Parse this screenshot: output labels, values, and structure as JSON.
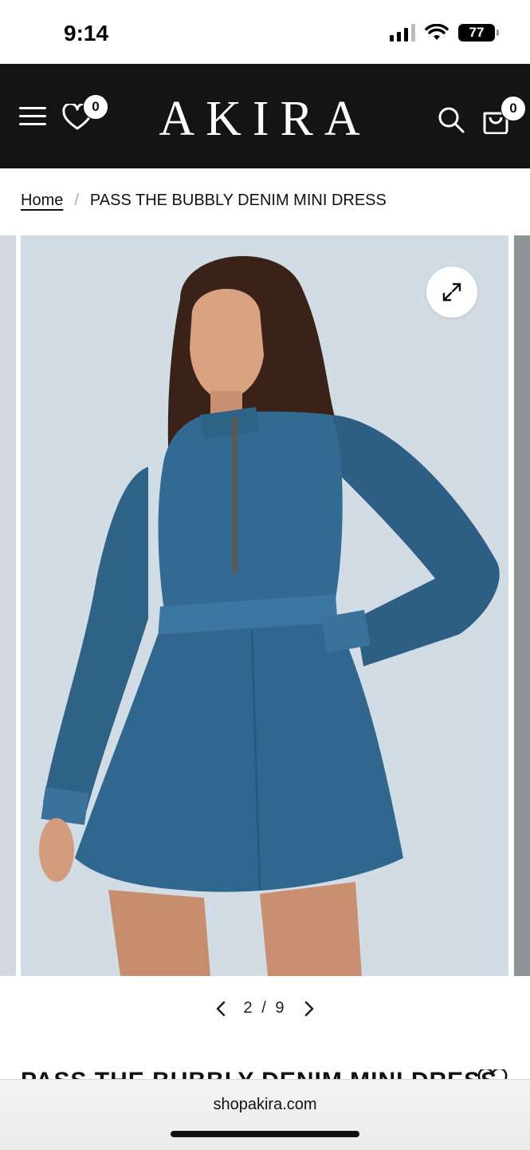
{
  "status_bar": {
    "time": "9:14",
    "battery": "77"
  },
  "header": {
    "brand": "AKIRA",
    "wishlist_count": "0",
    "cart_count": "0",
    "colors": {
      "background": "#141414",
      "foreground": "#ffffff"
    }
  },
  "breadcrumb": {
    "home": "Home",
    "separator": "/",
    "current": "PASS THE BUBBLY DENIM MINI DRESS"
  },
  "gallery": {
    "current": "2",
    "separator": "/",
    "total": "9",
    "prev_icon": "chevron-left-icon",
    "next_icon": "chevron-right-icon",
    "zoom_icon": "expand-icon"
  },
  "product": {
    "title": "PASS THE BUBBLY DENIM MINI DRESS"
  },
  "browser": {
    "url": "shopakira.com"
  }
}
